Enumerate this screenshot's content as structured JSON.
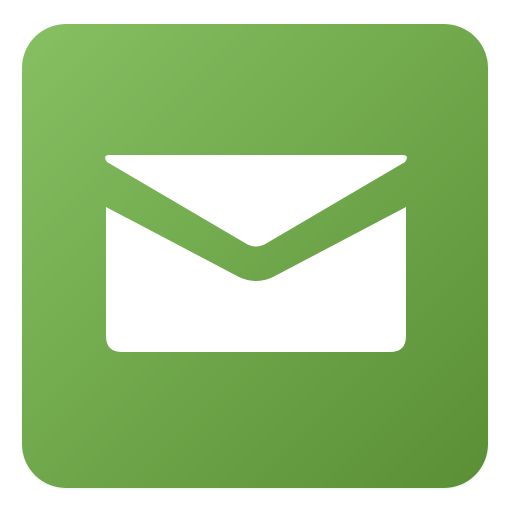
{
  "app_icon": {
    "icon": "envelope-icon",
    "colors": {
      "tile_gradient_start": "#86c063",
      "tile_gradient_end": "#5a8f35",
      "glyph": "#ffffff"
    }
  }
}
